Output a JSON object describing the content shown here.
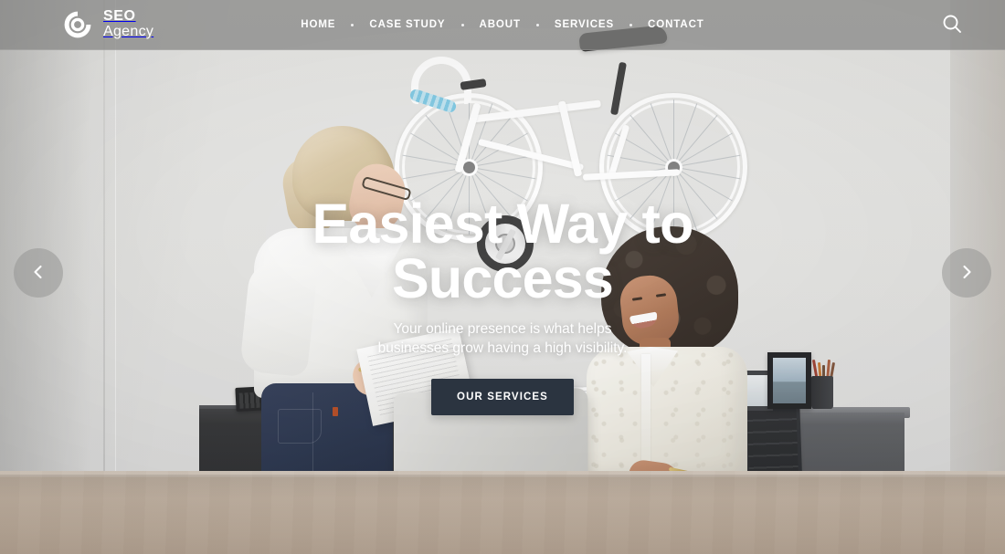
{
  "site": {
    "brand_line1": "SEO",
    "brand_line2": "Agency",
    "logo_icon": "circular-target-icon"
  },
  "header": {
    "nav": [
      {
        "label": "HOME",
        "name": "home"
      },
      {
        "label": "CASE STUDY",
        "name": "case-study"
      },
      {
        "label": "ABOUT",
        "name": "about"
      },
      {
        "label": "SERVICES",
        "name": "services"
      },
      {
        "label": "CONTACT",
        "name": "contact"
      }
    ],
    "search_icon": "search-icon",
    "background_color": "#848482"
  },
  "hero": {
    "title_line1": "Easiest Way to",
    "title_line2": "Success",
    "subtitle": "Your online presence is what helps businesses grow having a high visibility.",
    "cta_label": "OUR SERVICES",
    "cta_color": "#2b3440",
    "text_color": "#ffffff"
  },
  "carousel": {
    "prev_label": "‹",
    "prev_icon": "chevron-left-icon",
    "next_label": "›",
    "next_icon": "chevron-right-icon",
    "arrow_color": "#969694"
  },
  "scene": {
    "description": "Two women working at an office desk with a laptop; white bicycle mounted on the wall behind them",
    "accent_blue": "#4aa8d8",
    "wall_color": "#e6e6e4",
    "desk_color": "#c3b3a3"
  }
}
